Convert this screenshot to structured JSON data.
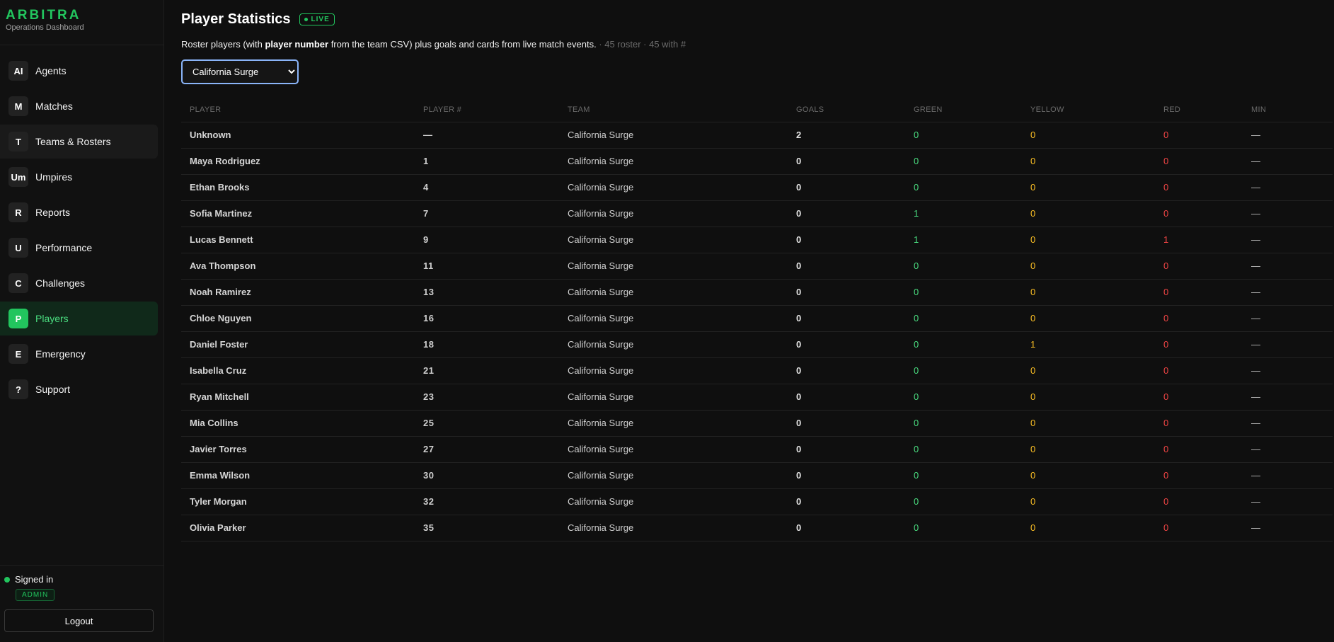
{
  "brand": {
    "name": "ARBITRA",
    "subtitle": "Operations Dashboard"
  },
  "nav": [
    {
      "badge": "AI",
      "label": "Agents"
    },
    {
      "badge": "M",
      "label": "Matches"
    },
    {
      "badge": "T",
      "label": "Teams & Rosters"
    },
    {
      "badge": "Um",
      "label": "Umpires"
    },
    {
      "badge": "R",
      "label": "Reports"
    },
    {
      "badge": "U",
      "label": "Performance"
    },
    {
      "badge": "C",
      "label": "Challenges"
    },
    {
      "badge": "P",
      "label": "Players"
    },
    {
      "badge": "E",
      "label": "Emergency"
    },
    {
      "badge": "?",
      "label": "Support"
    }
  ],
  "footer": {
    "status": "Signed in",
    "role": "ADMIN",
    "logout": "Logout"
  },
  "page": {
    "title": "Player Statistics",
    "live": "LIVE",
    "desc_pre": "Roster players (with ",
    "desc_bold": "player number",
    "desc_post": " from the team CSV) plus goals and cards from live match events.",
    "desc_meta": " · 45 roster · 45 with #"
  },
  "team_select": {
    "value": "California Surge"
  },
  "table": {
    "headers": [
      "PLAYER",
      "PLAYER #",
      "TEAM",
      "GOALS",
      "GREEN",
      "YELLOW",
      "RED",
      "MIN"
    ],
    "rows": [
      [
        "Unknown",
        "—",
        "California Surge",
        "2",
        "0",
        "0",
        "0",
        "—"
      ],
      [
        "Maya Rodriguez",
        "1",
        "California Surge",
        "0",
        "0",
        "0",
        "0",
        "—"
      ],
      [
        "Ethan Brooks",
        "4",
        "California Surge",
        "0",
        "0",
        "0",
        "0",
        "—"
      ],
      [
        "Sofia Martinez",
        "7",
        "California Surge",
        "0",
        "1",
        "0",
        "0",
        "—"
      ],
      [
        "Lucas Bennett",
        "9",
        "California Surge",
        "0",
        "1",
        "0",
        "1",
        "—"
      ],
      [
        "Ava Thompson",
        "11",
        "California Surge",
        "0",
        "0",
        "0",
        "0",
        "—"
      ],
      [
        "Noah Ramirez",
        "13",
        "California Surge",
        "0",
        "0",
        "0",
        "0",
        "—"
      ],
      [
        "Chloe Nguyen",
        "16",
        "California Surge",
        "0",
        "0",
        "0",
        "0",
        "—"
      ],
      [
        "Daniel Foster",
        "18",
        "California Surge",
        "0",
        "0",
        "1",
        "0",
        "—"
      ],
      [
        "Isabella Cruz",
        "21",
        "California Surge",
        "0",
        "0",
        "0",
        "0",
        "—"
      ],
      [
        "Ryan Mitchell",
        "23",
        "California Surge",
        "0",
        "0",
        "0",
        "0",
        "—"
      ],
      [
        "Mia Collins",
        "25",
        "California Surge",
        "0",
        "0",
        "0",
        "0",
        "—"
      ],
      [
        "Javier Torres",
        "27",
        "California Surge",
        "0",
        "0",
        "0",
        "0",
        "—"
      ],
      [
        "Emma Wilson",
        "30",
        "California Surge",
        "0",
        "0",
        "0",
        "0",
        "—"
      ],
      [
        "Tyler Morgan",
        "32",
        "California Surge",
        "0",
        "0",
        "0",
        "0",
        "—"
      ],
      [
        "Olivia Parker",
        "35",
        "California Surge",
        "0",
        "0",
        "0",
        "0",
        "—"
      ]
    ]
  },
  "colors": {
    "accent": "#22c55e",
    "green": "#4ade80",
    "yellow": "#fbbf24",
    "red": "#ef4444",
    "background": "#0f0f0f"
  }
}
